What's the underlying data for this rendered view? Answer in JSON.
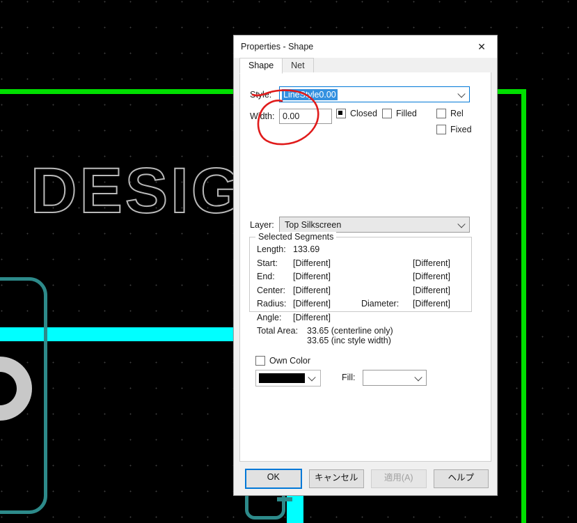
{
  "canvas": {
    "silkscreen_text": "DESIGN",
    "colors": {
      "background": "#000000",
      "grid_dot": "#4a4a4a",
      "green_trace": "#00e000",
      "cyan_trace": "#00ffff",
      "teal_outline": "#2d8a8a",
      "pad_gray": "#c8c8c8",
      "silkscreen": "#b9b9b9"
    }
  },
  "dialog": {
    "title": "Properties - Shape",
    "close_label": "✕",
    "tabs": [
      {
        "label": "Shape",
        "active": true
      },
      {
        "label": "Net",
        "active": false
      }
    ],
    "style": {
      "label": "Style:",
      "value": "LineStyle0.00",
      "selected": true
    },
    "width": {
      "label": "Width:",
      "value": "0.00"
    },
    "checkboxes": [
      {
        "name": "closed",
        "label": "Closed",
        "state": "indeterminate"
      },
      {
        "name": "filled",
        "label": "Filled",
        "state": "unchecked"
      },
      {
        "name": "rel",
        "label": "Rel",
        "state": "unchecked"
      },
      {
        "name": "fixed",
        "label": "Fixed",
        "state": "unchecked"
      }
    ],
    "layer": {
      "label": "Layer:",
      "value": "Top Silkscreen"
    },
    "selected_segments": {
      "legend": "Selected Segments",
      "rows": [
        {
          "key": "Length:",
          "v1": "133.69",
          "k2": "",
          "v2": ""
        },
        {
          "key": "Start:",
          "v1": "[Different]",
          "k2": "",
          "v2": "[Different]"
        },
        {
          "key": "End:",
          "v1": "[Different]",
          "k2": "",
          "v2": "[Different]"
        },
        {
          "key": "Center:",
          "v1": "[Different]",
          "k2": "",
          "v2": "[Different]"
        },
        {
          "key": "Radius:",
          "v1": "[Different]",
          "k2": "Diameter:",
          "v2": "[Different]"
        },
        {
          "key": "Angle:",
          "v1": "[Different]",
          "k2": "",
          "v2": ""
        }
      ]
    },
    "total_area": {
      "label": "Total Area:",
      "line1": "33.65 (centerline only)",
      "line2": "33.65 (inc style width)"
    },
    "own_color": {
      "label": "Own Color",
      "state": "unchecked",
      "swatch_hex": "#000000"
    },
    "fill": {
      "label": "Fill:",
      "value": ""
    },
    "buttons": [
      {
        "name": "ok",
        "label": "OK",
        "style": "default"
      },
      {
        "name": "cancel",
        "label": "キャンセル",
        "style": "normal"
      },
      {
        "name": "apply",
        "label": "適用(A)",
        "style": "disabled"
      },
      {
        "name": "help",
        "label": "ヘルプ",
        "style": "normal"
      }
    ]
  },
  "annotation": {
    "color": "#e01b1b",
    "shape": "hand-drawn-ellipse"
  }
}
